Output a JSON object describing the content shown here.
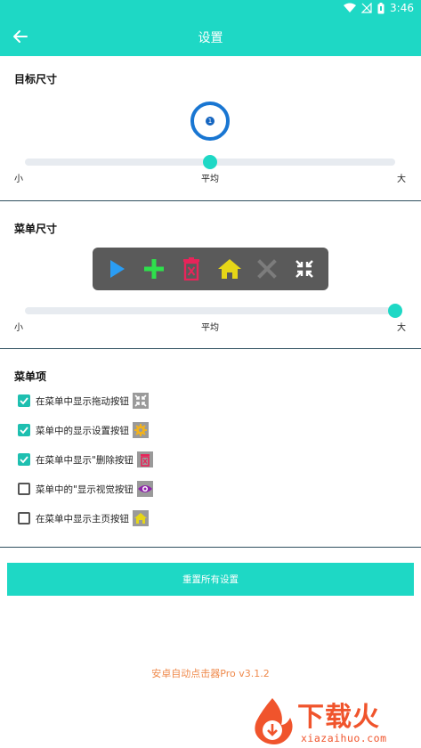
{
  "status_bar": {
    "time": "3:46"
  },
  "app_bar": {
    "title": "设置"
  },
  "target_size": {
    "title": "目标尺寸",
    "target_label": "1",
    "slider": {
      "value_fraction": 0.5,
      "min_label": "小",
      "mid_label": "平均",
      "max_label": "大"
    }
  },
  "menu_size": {
    "title": "菜单尺寸",
    "menu_icons": [
      "play-icon",
      "plus-icon",
      "delete-icon",
      "home-icon",
      "close-icon",
      "drag-icon"
    ],
    "slider": {
      "value_fraction": 1.0,
      "min_label": "小",
      "mid_label": "平均",
      "max_label": "大"
    }
  },
  "menu_items": {
    "title": "菜单项",
    "items": [
      {
        "label": "在菜单中显示拖动按钮",
        "checked": true,
        "icon": "drag-icon"
      },
      {
        "label": "菜单中的显示设置按钮",
        "checked": true,
        "icon": "settings-gear-icon"
      },
      {
        "label": "在菜单中显示\"删除按钮",
        "checked": true,
        "icon": "delete-icon"
      },
      {
        "label": "菜单中的\"显示视觉按钮",
        "checked": false,
        "icon": "eye-icon"
      },
      {
        "label": "在菜单中显示主页按钮",
        "checked": false,
        "icon": "home-icon"
      }
    ]
  },
  "reset_button": {
    "label": "重置所有设置"
  },
  "version": "安卓自动点击器Pro v3.1.2",
  "watermark": {
    "text": "下载火",
    "sub": "xiazaihuo.com"
  },
  "colors": {
    "accent": "#1ed8c5",
    "target": "#1976d2",
    "version": "#ef8a4c"
  }
}
